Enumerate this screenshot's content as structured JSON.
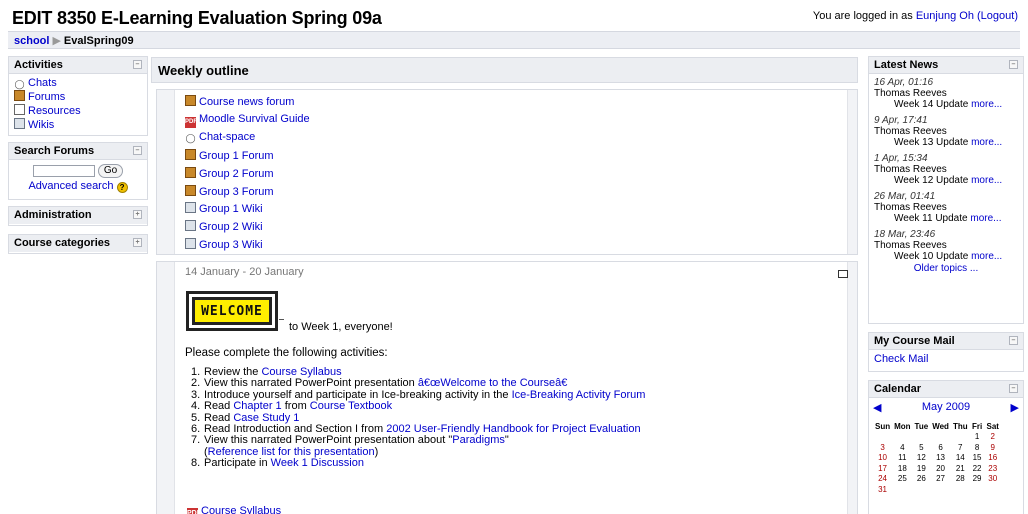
{
  "header": {
    "site_title": "EDIT 8350 E-Learning Evaluation Spring 09a",
    "login_prefix": "You are logged in as ",
    "login_user": "Eunjung Oh",
    "logout_label": "(Logout)"
  },
  "navbar": {
    "home": "school",
    "separator": "▶",
    "current": "EvalSpring09"
  },
  "left": {
    "activities": {
      "title": "Activities",
      "items": [
        {
          "label": "Chats",
          "icon": "chat-icon"
        },
        {
          "label": "Forums",
          "icon": "forum-icon"
        },
        {
          "label": "Resources",
          "icon": "resource-icon"
        },
        {
          "label": "Wikis",
          "icon": "wiki-icon"
        }
      ]
    },
    "search": {
      "title": "Search Forums",
      "go_label": "Go",
      "advanced_label": "Advanced search"
    },
    "administration": {
      "title": "Administration"
    },
    "course_categories": {
      "title": "Course categories"
    }
  },
  "main": {
    "weekly_outline_title": "Weekly outline",
    "section0": {
      "items": [
        {
          "label": "Course news forum",
          "icon": "forum-icon"
        },
        {
          "label": "Moodle Survival Guide",
          "icon": "pdf-icon"
        },
        {
          "label": "Chat-space",
          "icon": "chat-icon"
        },
        {
          "label": "Group 1 Forum",
          "icon": "forum-icon"
        },
        {
          "label": "Group 2 Forum",
          "icon": "forum-icon"
        },
        {
          "label": "Group 3 Forum",
          "icon": "forum-icon"
        },
        {
          "label": "Group 1 Wiki",
          "icon": "wiki-icon"
        },
        {
          "label": "Group 2 Wiki",
          "icon": "wiki-icon"
        },
        {
          "label": "Group 3 Wiki",
          "icon": "wiki-icon"
        }
      ]
    },
    "week1": {
      "date_range": "14 January - 20 January",
      "welcome_banner": "WELCOME",
      "welcome_text": "to Week 1, everyone!",
      "intro": "Please complete the following activities:",
      "tasks": [
        {
          "num": "1.",
          "text": "Review the ",
          "link": "Course Syllabus",
          "after": ""
        },
        {
          "num": "2.",
          "text": "View this narrated PowerPoint presentation ",
          "link": "â€œWelcome to the Courseâ€",
          "after": ""
        },
        {
          "num": "3.",
          "text": "Introduce yourself and participate in Ice-breaking activity in the ",
          "link": "Ice-Breaking Activity Forum",
          "after": ""
        },
        {
          "num": "4.",
          "text": "Read ",
          "link": "Chapter 1",
          "mid": " from ",
          "link2": "Course Textbook"
        },
        {
          "num": "5.",
          "text": "Read ",
          "link": "Case Study 1",
          "after": ""
        },
        {
          "num": "6.",
          "text": "Read Introduction and Section I from ",
          "link": "2002 User-Friendly Handbook for Project Evaluation",
          "after": ""
        },
        {
          "num": "7.",
          "text": "View this narrated PowerPoint presentation about \"",
          "link": "Paradigms",
          "after": "\""
        },
        {
          "num": "",
          "text": "(",
          "link": "Reference list for this presentation",
          "after": ")"
        },
        {
          "num": "8.",
          "text": "Participate in ",
          "link": "Week 1 Discussion",
          "after": ""
        }
      ],
      "resource_label": "Course Syllabus"
    }
  },
  "right": {
    "latest_news": {
      "title": "Latest News",
      "entries": [
        {
          "date": "16 Apr, 01:16",
          "author": "Thomas Reeves",
          "subject": "Week 14 Update",
          "more": "more..."
        },
        {
          "date": "9 Apr, 17:41",
          "author": "Thomas Reeves",
          "subject": "Week 13 Update",
          "more": "more..."
        },
        {
          "date": "1 Apr, 15:34",
          "author": "Thomas Reeves",
          "subject": "Week 12 Update",
          "more": "more..."
        },
        {
          "date": "26 Mar, 01:41",
          "author": "Thomas Reeves",
          "subject": "Week 11 Update",
          "more": "more..."
        },
        {
          "date": "18 Mar, 23:46",
          "author": "Thomas Reeves",
          "subject": "Week 10 Update",
          "more": "more..."
        }
      ],
      "older_topics": "Older topics ..."
    },
    "mail": {
      "title": "My Course Mail",
      "link": "Check Mail"
    },
    "calendar": {
      "title": "Calendar",
      "month": "May 2009",
      "weekdays": [
        "Sun",
        "Mon",
        "Tue",
        "Wed",
        "Thu",
        "Fri",
        "Sat"
      ],
      "weeks": [
        [
          "",
          "",
          "",
          "",
          "",
          "1",
          "2"
        ],
        [
          "3",
          "4",
          "5",
          "6",
          "7",
          "8",
          "9"
        ],
        [
          "10",
          "11",
          "12",
          "13",
          "14",
          "15",
          "16"
        ],
        [
          "17",
          "18",
          "19",
          "20",
          "21",
          "22",
          "23"
        ],
        [
          "24",
          "25",
          "26",
          "27",
          "28",
          "29",
          "30"
        ],
        [
          "31",
          "",
          "",
          "",
          "",
          "",
          ""
        ]
      ]
    }
  },
  "colors": {
    "link": "#0000cc",
    "block_header": "#eceef2",
    "banner_yellow": "#ffee00",
    "weekend_red": "#aa0000"
  }
}
